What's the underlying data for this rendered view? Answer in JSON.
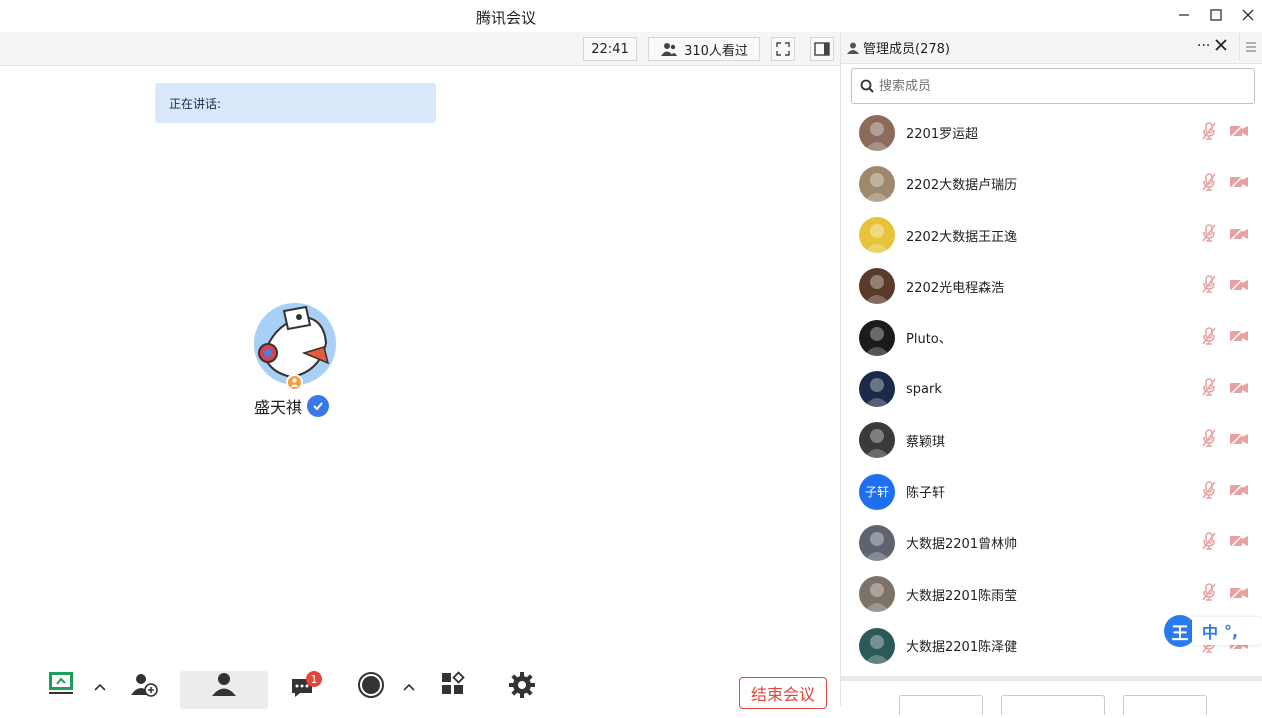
{
  "window": {
    "title": "腾讯会议"
  },
  "toolbar": {
    "time": "22:41",
    "viewers": "310人看过"
  },
  "stage": {
    "speaking_label": "正在讲话:",
    "speaker_name": "盛天祺"
  },
  "panel": {
    "title": "管理成员(278)",
    "more": "···",
    "search_placeholder": "搜索成员",
    "members": [
      {
        "name": "2201罗运超",
        "color": "#8a6b5c"
      },
      {
        "name": "2202大数据卢瑞历",
        "color": "#9d8a6e"
      },
      {
        "name": "2202大数据王正逸",
        "color": "#e6c33a"
      },
      {
        "name": "2202光电程森浩",
        "color": "#5a3a2a"
      },
      {
        "name": "Pluto、",
        "color": "#1b1b1b"
      },
      {
        "name": "spark",
        "color": "#1c2a4a"
      },
      {
        "name": "蔡颖琪",
        "color": "#3a3a3a"
      },
      {
        "name": "陈子轩",
        "color": "#1e6ff0",
        "text": "子轩"
      },
      {
        "name": "大数据2201曾林帅",
        "color": "#5d6470"
      },
      {
        "name": "大数据2201陈雨莹",
        "color": "#7d7267"
      },
      {
        "name": "大数据2201陈泽健",
        "color": "#2b5a5a"
      }
    ]
  },
  "end_button": "结束会议",
  "ime": {
    "logo": "王",
    "mode": "中",
    "punct": "°,"
  },
  "colors": {
    "accent": "#1e6ff0",
    "danger": "#e2453c",
    "speaking_bg": "#dbe8fb"
  }
}
